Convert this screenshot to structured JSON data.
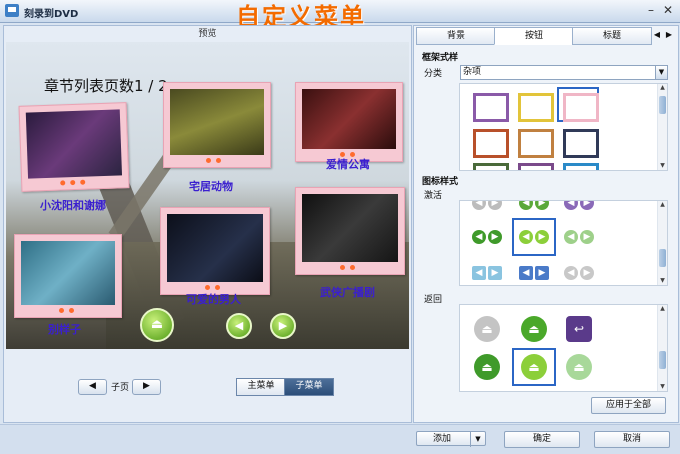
{
  "window": {
    "title": "刻录到DVD",
    "minimize": "–",
    "close": "✕"
  },
  "banner": "自定义菜单",
  "preview": {
    "header": "预览",
    "page_title": "章节列表页数1 / 2",
    "captions": [
      "小沈阳和谢娜",
      "宅居动物",
      "爱情公寓",
      "别样子",
      "可爱的男人",
      "武侠广播剧"
    ],
    "nav": {
      "prev": "◀",
      "label": "子页",
      "next": "▶"
    },
    "menu_tabs": {
      "main": "主菜单",
      "sub": "子菜单"
    }
  },
  "right": {
    "tabs": [
      "背景",
      "按钮",
      "标题"
    ],
    "active_tab": "按钮",
    "tab_prev": "◀",
    "tab_next": "▶",
    "frame_style_label": "框架式样",
    "category_label": "分类",
    "category_value": "杂项",
    "icon_style_label": "图标样式",
    "activate_label": "激活",
    "return_label": "返回",
    "apply_all": "应用于全部"
  },
  "footer": {
    "add": "添加",
    "ok": "确定",
    "cancel": "取消"
  },
  "colors": {
    "accent": "#2b66c5",
    "banner": "#f36b00",
    "caption": "#3a1fcf"
  }
}
